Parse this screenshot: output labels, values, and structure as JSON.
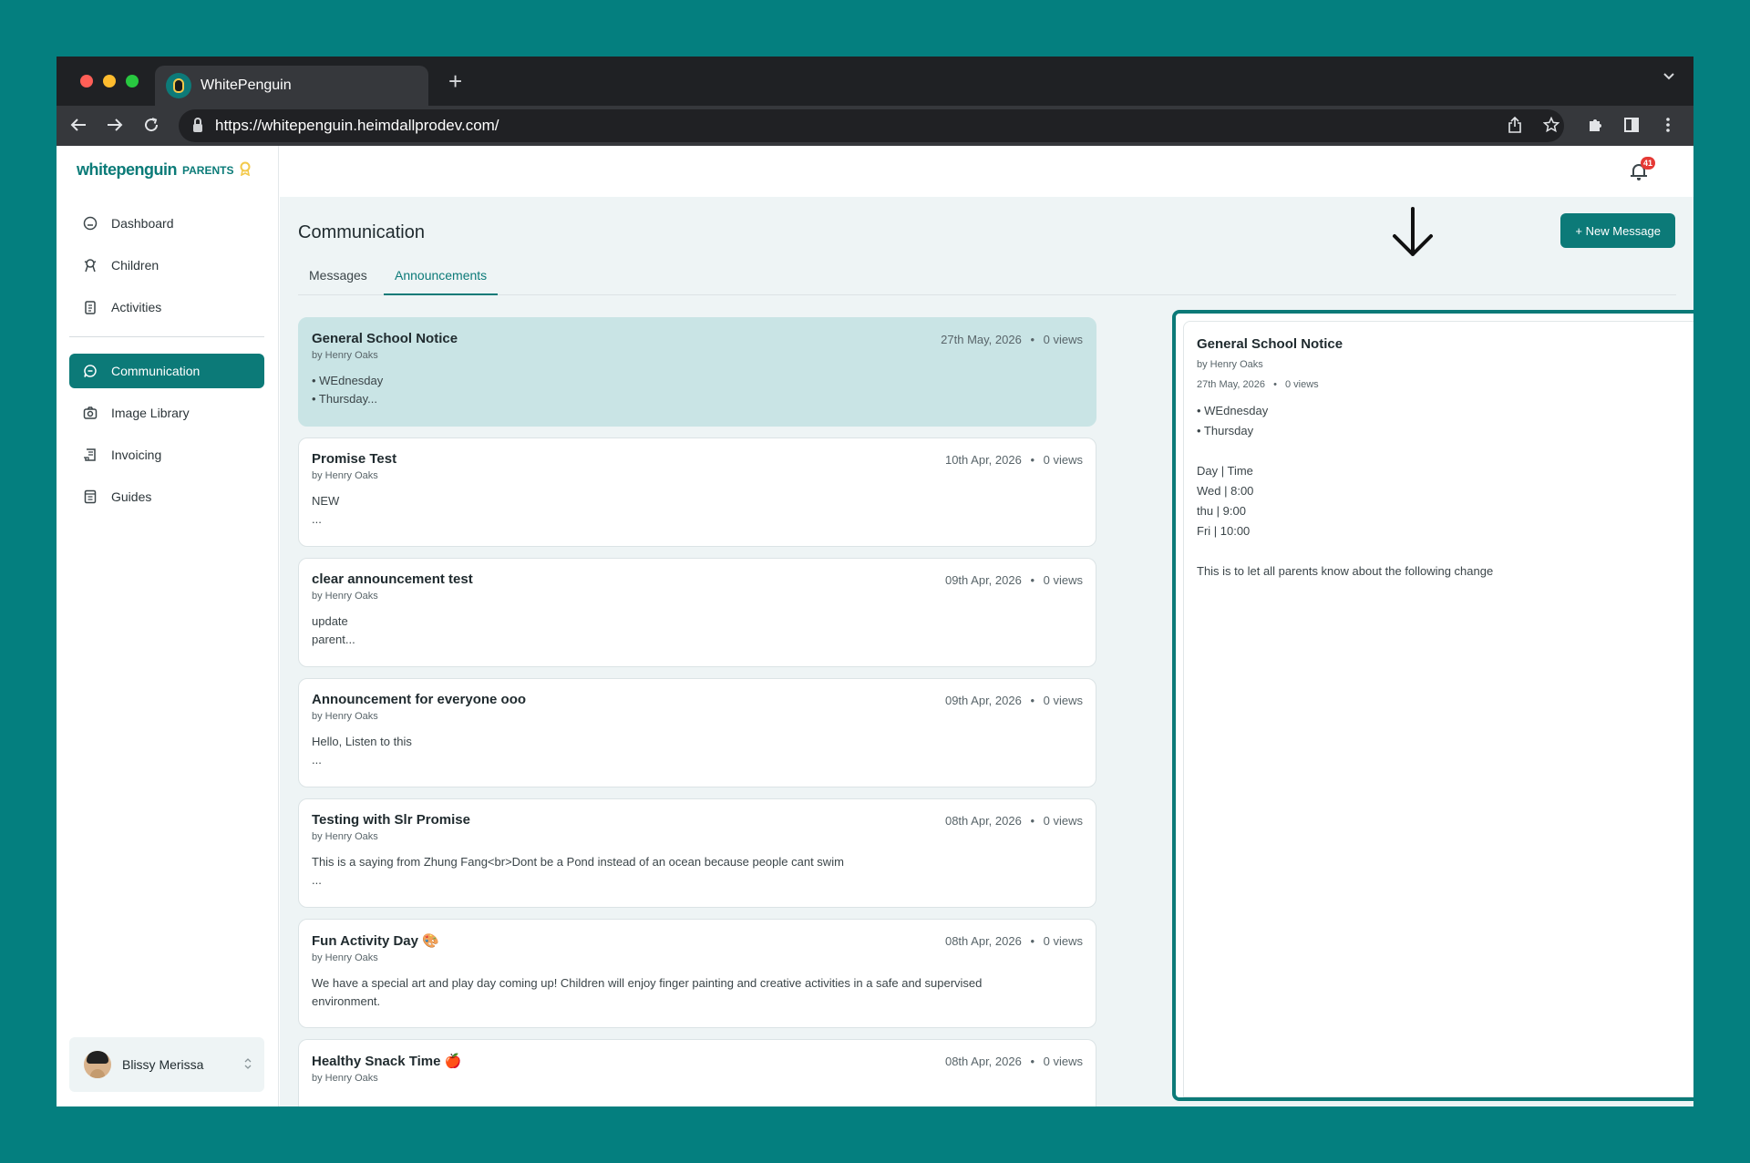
{
  "browser": {
    "tab_title": "WhitePenguin",
    "new_tab_symbol": "+",
    "url": "https://whitepenguin.heimdallprodev.com/"
  },
  "brand": {
    "name": "whitepenguin",
    "suffix": "PARENTS"
  },
  "sidebar": {
    "items": [
      {
        "label": "Dashboard",
        "icon": "dashboard-icon"
      },
      {
        "label": "Children",
        "icon": "children-icon"
      },
      {
        "label": "Activities",
        "icon": "activities-icon"
      },
      {
        "label": "Communication",
        "icon": "chat-icon",
        "active": true
      },
      {
        "label": "Image Library",
        "icon": "camera-icon"
      },
      {
        "label": "Invoicing",
        "icon": "invoice-icon"
      },
      {
        "label": "Guides",
        "icon": "guides-icon"
      }
    ],
    "user": {
      "name": "Blissy Merissa"
    }
  },
  "header": {
    "notification_count": "41"
  },
  "page": {
    "title": "Communication",
    "new_message_label": "+ New Message",
    "tabs": [
      {
        "label": "Messages",
        "selected": false
      },
      {
        "label": "Announcements",
        "selected": true
      }
    ]
  },
  "announcements": [
    {
      "title": "General School Notice",
      "author": "by Henry Oaks",
      "date": "27th May, 2026",
      "views": "0 views",
      "body": [
        "• WEdnesday",
        "• Thursday..."
      ],
      "selected": true
    },
    {
      "title": "Promise Test",
      "author": "by Henry Oaks",
      "date": "10th Apr, 2026",
      "views": "0 views",
      "body": [
        "NEW",
        "..."
      ]
    },
    {
      "title": "clear announcement test",
      "author": "by Henry Oaks",
      "date": "09th Apr, 2026",
      "views": "0 views",
      "body": [
        "update",
        "parent..."
      ]
    },
    {
      "title": "Announcement for everyone ooo",
      "author": "by Henry Oaks",
      "date": "09th Apr, 2026",
      "views": "0 views",
      "body": [
        "Hello, Listen to this",
        "..."
      ]
    },
    {
      "title": "Testing with Slr Promise",
      "author": "by Henry Oaks",
      "date": "08th Apr, 2026",
      "views": "0 views",
      "body": [
        "This is a saying from Zhung Fang<br>Dont be a Pond instead of an ocean because people cant swim",
        "..."
      ]
    },
    {
      "title": "Fun Activity Day 🎨",
      "author": "by Henry Oaks",
      "date": "08th Apr, 2026",
      "views": "0 views",
      "body": [
        "We have a special art and play day coming up! Children will enjoy finger painting and creative activities in a safe and supervised",
        "environment."
      ]
    },
    {
      "title": "Healthy Snack Time 🍎",
      "author": "by Henry Oaks",
      "date": "08th Apr, 2026",
      "views": "0 views",
      "body": []
    }
  ],
  "meta_separator": "•",
  "detail": {
    "title": "General School Notice",
    "author": "by Henry Oaks",
    "date": "27th May, 2026",
    "views": "0 views",
    "lines": [
      "• WEdnesday",
      "• Thursday",
      "",
      "Day | Time",
      "Wed | 8:00",
      "thu | 9:00",
      "Fri | 10:00",
      "",
      "This is to let all parents know about the following change"
    ]
  },
  "colors": {
    "accent": "#0c7a78",
    "background": "#047f7f",
    "selected_card": "#c9e4e5",
    "badge": "#e53935"
  }
}
